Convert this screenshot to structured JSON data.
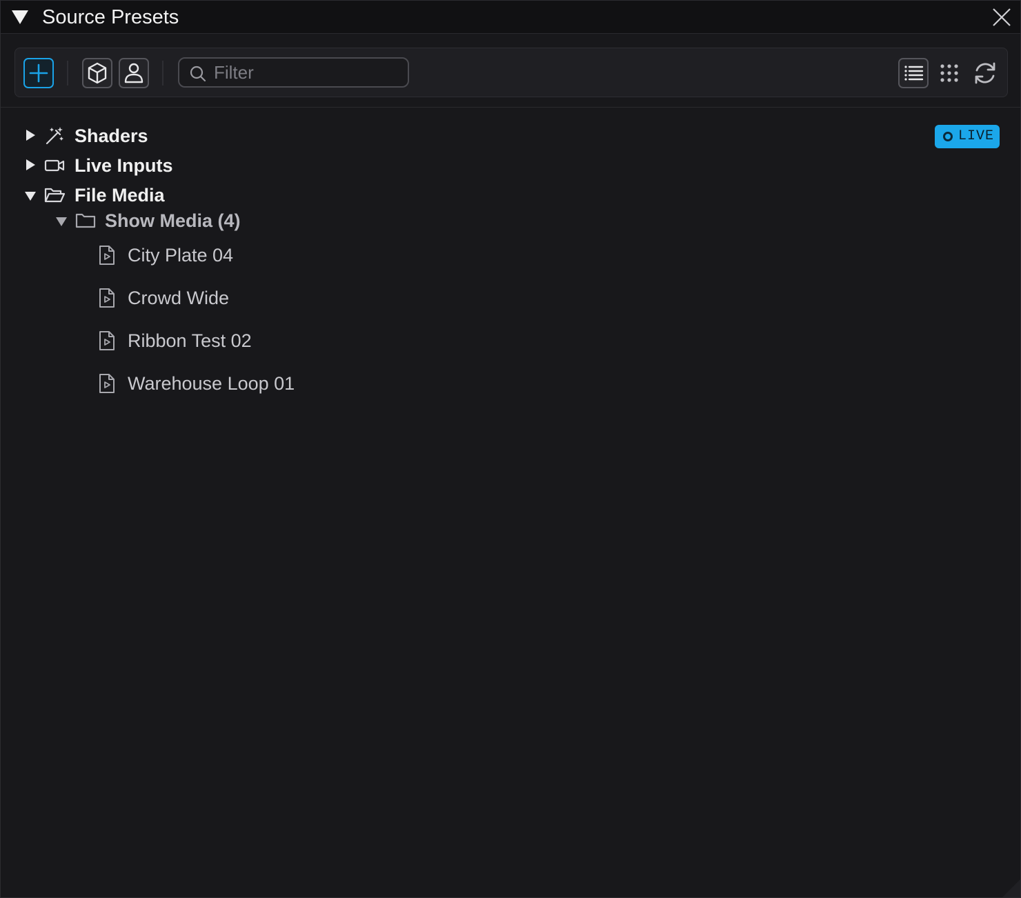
{
  "window": {
    "title": "Source Presets",
    "icons": {
      "collapse": "caret-down-icon",
      "close": "close-icon"
    }
  },
  "toolbar": {
    "add_icon": "plus-icon",
    "package_icon": "cube-icon",
    "user_icon": "user-icon",
    "filter": {
      "placeholder": "Filter",
      "value": ""
    },
    "view_list_icon": "list-view-icon",
    "view_grid_icon": "grid-view-icon",
    "refresh_icon": "refresh-icon"
  },
  "status": {
    "live_label": "LIVE",
    "color": "#1ba7ea"
  },
  "tree": {
    "shaders": {
      "label": "Shaders",
      "expanded": false,
      "icon": "magic-wand-icon"
    },
    "live_inputs": {
      "label": "Live Inputs",
      "expanded": false,
      "icon": "video-camera-icon"
    },
    "file_media": {
      "label": "File Media",
      "expanded": true,
      "icon": "folder-open-icon",
      "folder": {
        "label": "Show Media (4)",
        "expanded": true,
        "icon": "folder-icon",
        "items": [
          {
            "label": "City Plate 04",
            "icon": "video-file-icon"
          },
          {
            "label": "Crowd Wide",
            "icon": "video-file-icon"
          },
          {
            "label": "Ribbon Test 02",
            "icon": "video-file-icon"
          },
          {
            "label": "Warehouse Loop 01",
            "icon": "video-file-icon"
          }
        ]
      }
    }
  },
  "colors": {
    "accent": "#1ba7ea",
    "background": "#18181b",
    "toolbar": "#1f1f23"
  }
}
